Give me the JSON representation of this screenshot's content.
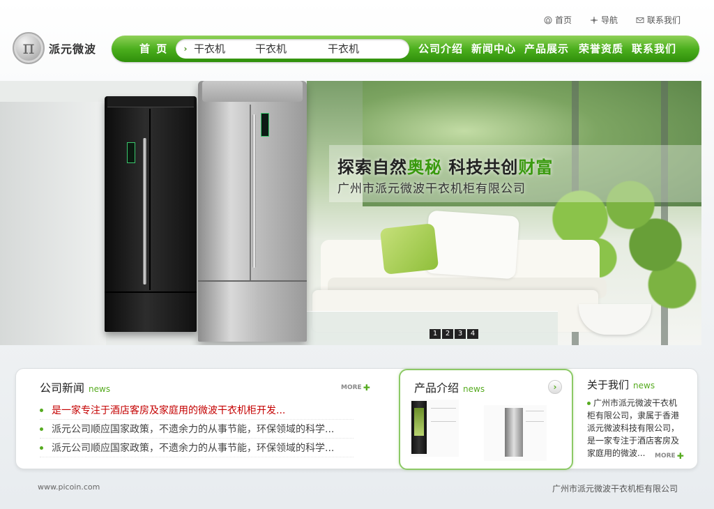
{
  "top_links": {
    "home": "首页",
    "nav": "导航",
    "contact": "联系我们"
  },
  "logo": {
    "mark": "π",
    "name": "派元微波"
  },
  "nav": {
    "home": "首 页",
    "sub": [
      "干衣机",
      "干衣机",
      "干衣机"
    ],
    "main": [
      "公司介绍",
      "新闻中心",
      "产品展示",
      "荣誉资质",
      "联系我们"
    ]
  },
  "banner": {
    "slogan_a": "探索自然",
    "slogan_b": "奥秘",
    "slogan_c": " 科技共创",
    "slogan_d": "财富",
    "company": "广州市派元微波干衣机柜有限公司",
    "pages": [
      "1",
      "2",
      "3",
      "4"
    ]
  },
  "news": {
    "title": "公司新闻",
    "title_en": "news",
    "more": "MORE",
    "items": [
      "是一家专注于酒店客房及家庭用的微波干衣机柜开发...",
      "派元公司顺应国家政策，不遗余力的从事节能，环保领域的科学...",
      "派元公司顺应国家政策，不遗余力的从事节能，环保领域的科学..."
    ]
  },
  "products": {
    "title": "产品介绍",
    "title_en": "news"
  },
  "about": {
    "title": "关于我们",
    "title_en": "news",
    "text": "广州市派元微波干衣机柜有限公司，隶属于香港派元微波科技有限公司，是一家专注于酒店客房及家庭用的微波...",
    "more": "MORE"
  },
  "footer": {
    "url": "www.picoin.com",
    "company": "广州市派元微波干衣机柜有限公司"
  },
  "colors": {
    "brand_green": "#56ab20",
    "hot_red": "#c40000"
  }
}
